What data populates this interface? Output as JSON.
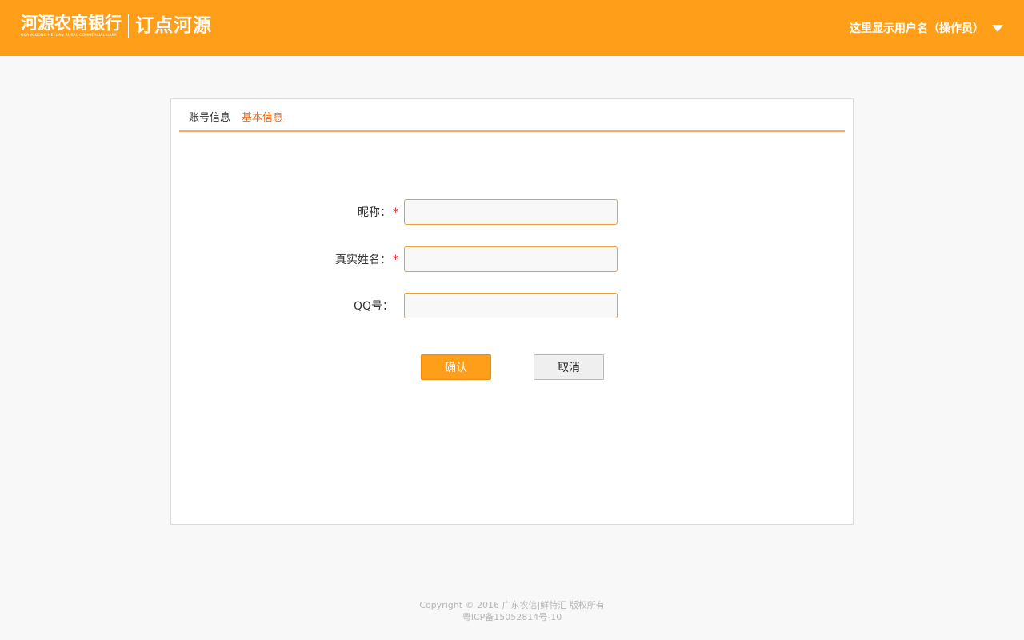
{
  "header": {
    "brand_bank_cn": "河源农商银行",
    "brand_bank_en": "GUANGDONG HEYUAN RURAL COMMERCIAL BANK",
    "brand_app": "订点河源",
    "user_label": "这里显示用户名（操作员）"
  },
  "tabs": [
    {
      "label": "账号信息",
      "active": false
    },
    {
      "label": "基本信息",
      "active": true
    }
  ],
  "form": {
    "nickname_label": "昵称：",
    "nickname_value": "",
    "realname_label": "真实姓名：",
    "realname_value": "",
    "qq_label": "QQ号：",
    "qq_value": "",
    "required_mark": "*",
    "confirm_label": "确认",
    "cancel_label": "取消"
  },
  "footer": {
    "copyright": "Copyright © 2016 广东农信|鲜特汇 版权所有",
    "icp": "粤ICP备15052814号-10"
  },
  "colors": {
    "accent": "#ff9f19",
    "active_tab": "#f06d1c",
    "required": "#e02020"
  }
}
